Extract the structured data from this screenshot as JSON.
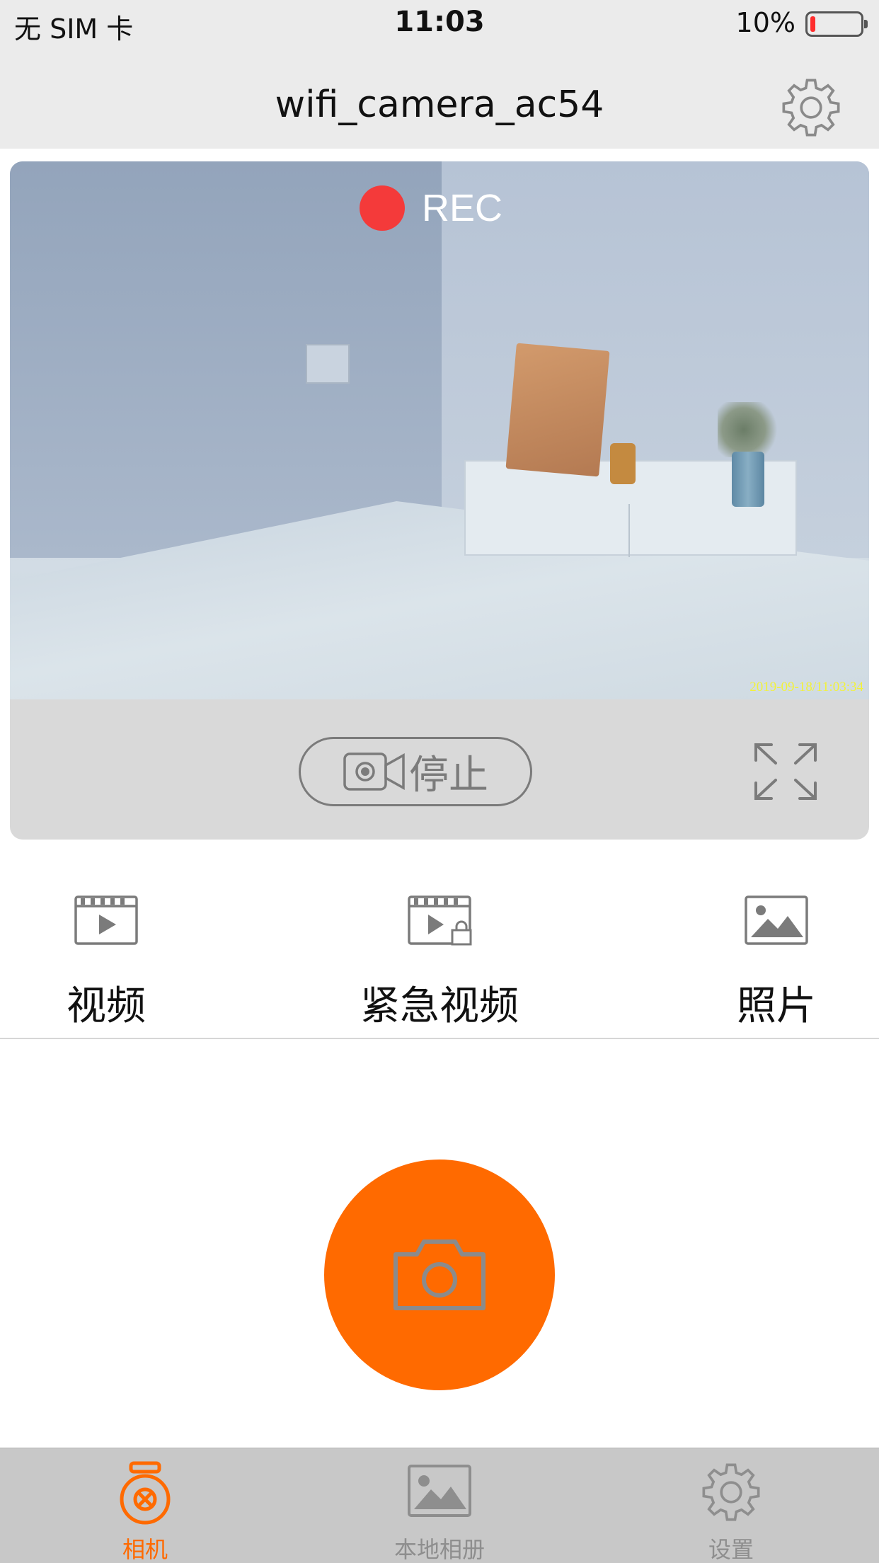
{
  "status_bar": {
    "carrier": "无 SIM 卡",
    "time": "11:03",
    "battery_percent": "10%",
    "battery_level": 0.1,
    "battery_color": "#ff2d2d"
  },
  "nav": {
    "title": "wifi_camera_ac54",
    "settings_icon": "gear-icon"
  },
  "preview": {
    "rec_label": "REC",
    "timestamp": "2019-09-18/11:03:34",
    "rec_color": "#f43a3a"
  },
  "controls": {
    "stop_label": "停止",
    "record_icon": "video-camera-icon",
    "fullscreen_icon": "expand-icon"
  },
  "categories": [
    {
      "label": "视频",
      "icon": "video-icon"
    },
    {
      "label": "紧急视频",
      "icon": "locked-video-icon"
    },
    {
      "label": "照片",
      "icon": "photo-icon"
    }
  ],
  "shutter": {
    "icon": "camera-icon",
    "color": "#ff6a00"
  },
  "tabs": [
    {
      "label": "相机",
      "icon": "camera-tab-icon",
      "active": true
    },
    {
      "label": "本地相册",
      "icon": "album-icon",
      "active": false
    },
    {
      "label": "设置",
      "icon": "settings-tab-icon",
      "active": false
    }
  ],
  "colors": {
    "accent": "#ff6a00",
    "bar_bg": "#ebebeb",
    "tab_bg": "#c8c8c8"
  }
}
